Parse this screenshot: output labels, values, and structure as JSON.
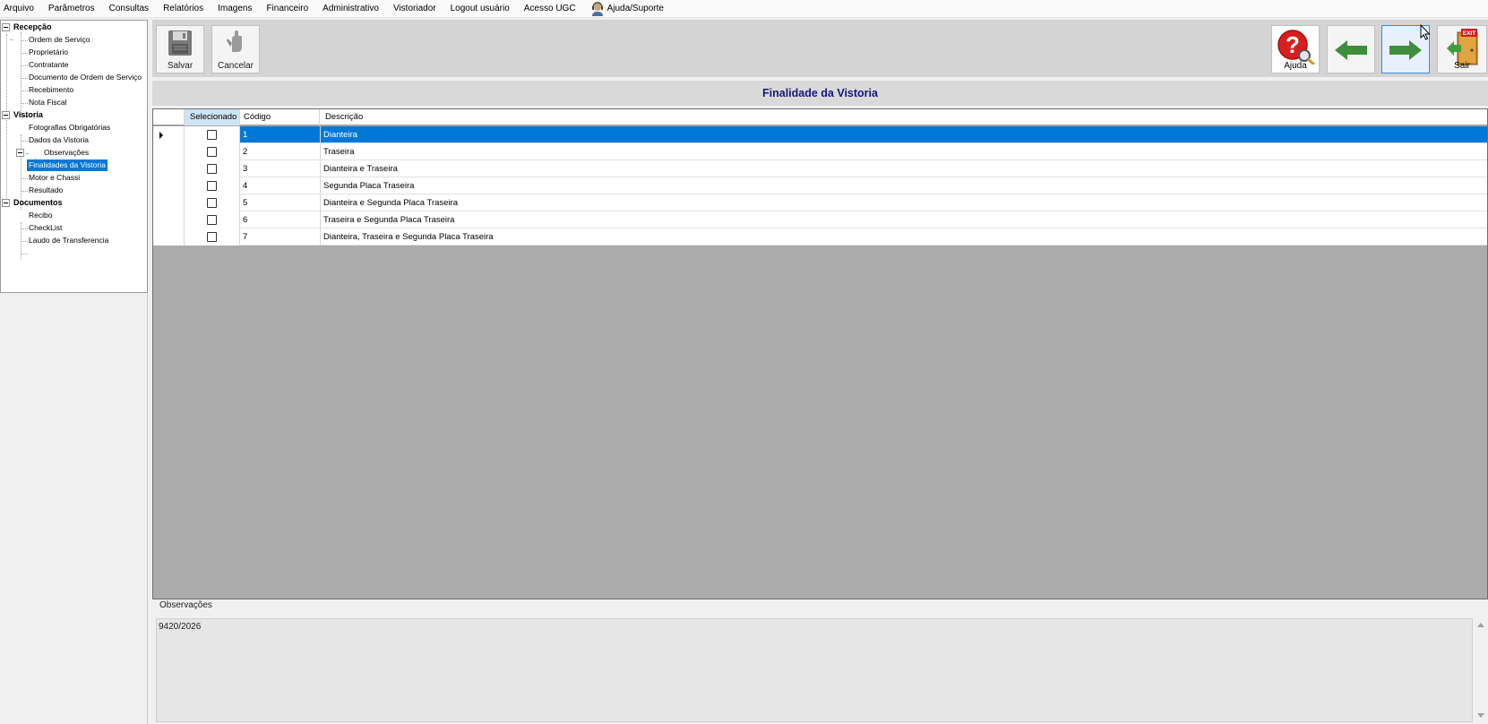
{
  "menu": {
    "items": [
      "Arquivo",
      "Parâmetros",
      "Consultas",
      "Relatórios",
      "Imagens",
      "Financeiro",
      "Administrativo",
      "Vistoriador",
      "Logout usuário",
      "Acesso UGC"
    ],
    "help_label": "Ajuda/Suporte"
  },
  "tree": {
    "recepcao": "Recepção",
    "ordem_servico": "Ordem de Serviço",
    "proprietario": "Proprietário",
    "contratante": "Contratante",
    "documento_os": "Documento de Ordem de Serviço",
    "recebimento": "Recebimento",
    "nota_fiscal": "Nota Fiscal",
    "vistoria": "Vistoria",
    "fotografias": "Fotografias Obrigatórias",
    "dados_vistoria": "Dados da Vistoria",
    "observacoes": "Observações",
    "finalidades": "Finalidades da Vistoria",
    "motor_chassi": "Motor e Chassi",
    "resultado": "Resultado",
    "documentos": "Documentos",
    "recibo": "Recibo",
    "checklist": "CheckList",
    "laudo": "Laudo de Transferencia"
  },
  "toolbar": {
    "save_label": "Salvar",
    "cancel_label": "Cancelar",
    "help_label": "Ajuda",
    "exit_label": "Sair",
    "exit_sign": "EXIT"
  },
  "page": {
    "title": "Finalidade da Vistoria"
  },
  "grid": {
    "headers": {
      "selected": "Selecionado",
      "code": "Código",
      "description": "Descrição"
    },
    "rows": [
      {
        "code": "1",
        "description": "Dianteira"
      },
      {
        "code": "2",
        "description": "Traseira"
      },
      {
        "code": "3",
        "description": "Dianteira e Traseira"
      },
      {
        "code": "4",
        "description": "Segunda Placa Traseira"
      },
      {
        "code": "5",
        "description": "Dianteira e Segunda Placa Traseira"
      },
      {
        "code": "6",
        "description": "Traseira e Segunda Placa Traseira"
      },
      {
        "code": "7",
        "description": "Dianteira, Traseira e Segunda Placa Traseira"
      }
    ]
  },
  "observations": {
    "label": "Observações",
    "value": "9420/2026"
  },
  "colors": {
    "selection": "#0078d7",
    "title_text": "#17177a",
    "grid_background": "#ababab"
  }
}
